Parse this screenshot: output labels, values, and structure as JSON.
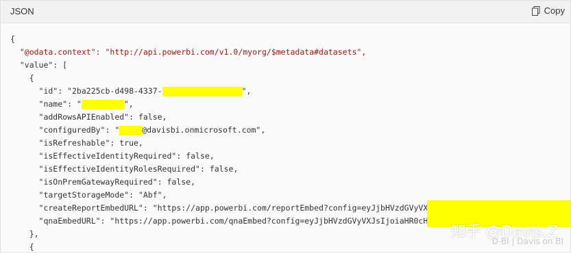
{
  "header": {
    "language": "JSON",
    "copy_label": "Copy",
    "copy_icon": "copy-icon"
  },
  "code_lines": [
    "{",
    "  \"@odata.context\": \"http://api.powerbi.com/v1.0/myorg/$metadata#datasets\",",
    "  \"value\": [",
    "    {",
    "      \"id\": \"2ba225cb-d498-4337-",
    "      \"name\": \"",
    "      \"addRowsAPIEnabled\": false,",
    "      \"configuredBy\": \"",
    "      \"isRefreshable\": true,",
    "      \"isEffectiveIdentityRequired\": false,",
    "      \"isEffectiveIdentityRolesRequired\": false,",
    "      \"isOnPremGatewayRequired\": false,",
    "      \"targetStorageMode\": \"Abf\",",
    "      \"createReportEmbedURL\": \"https://app.powerbi.com/reportEmbed?config=eyJjbHVzdGVyVXJsIj",
    "      \"qnaEmbedURL\": \"https://app.powerbi.com/qnaEmbed?config=eyJjbHVzdGVyVXJsIjoiaHR0cHM6Ly",
    "    },",
    "    {"
  ],
  "code_suffixes": {
    "id": "\",",
    "name": "\",",
    "configuredBy": "@davisbi.onmicrosoft.com\","
  },
  "watermark": {
    "main": "知乎 @Davis.Z",
    "sub": "D-BI | Davis on BI"
  }
}
